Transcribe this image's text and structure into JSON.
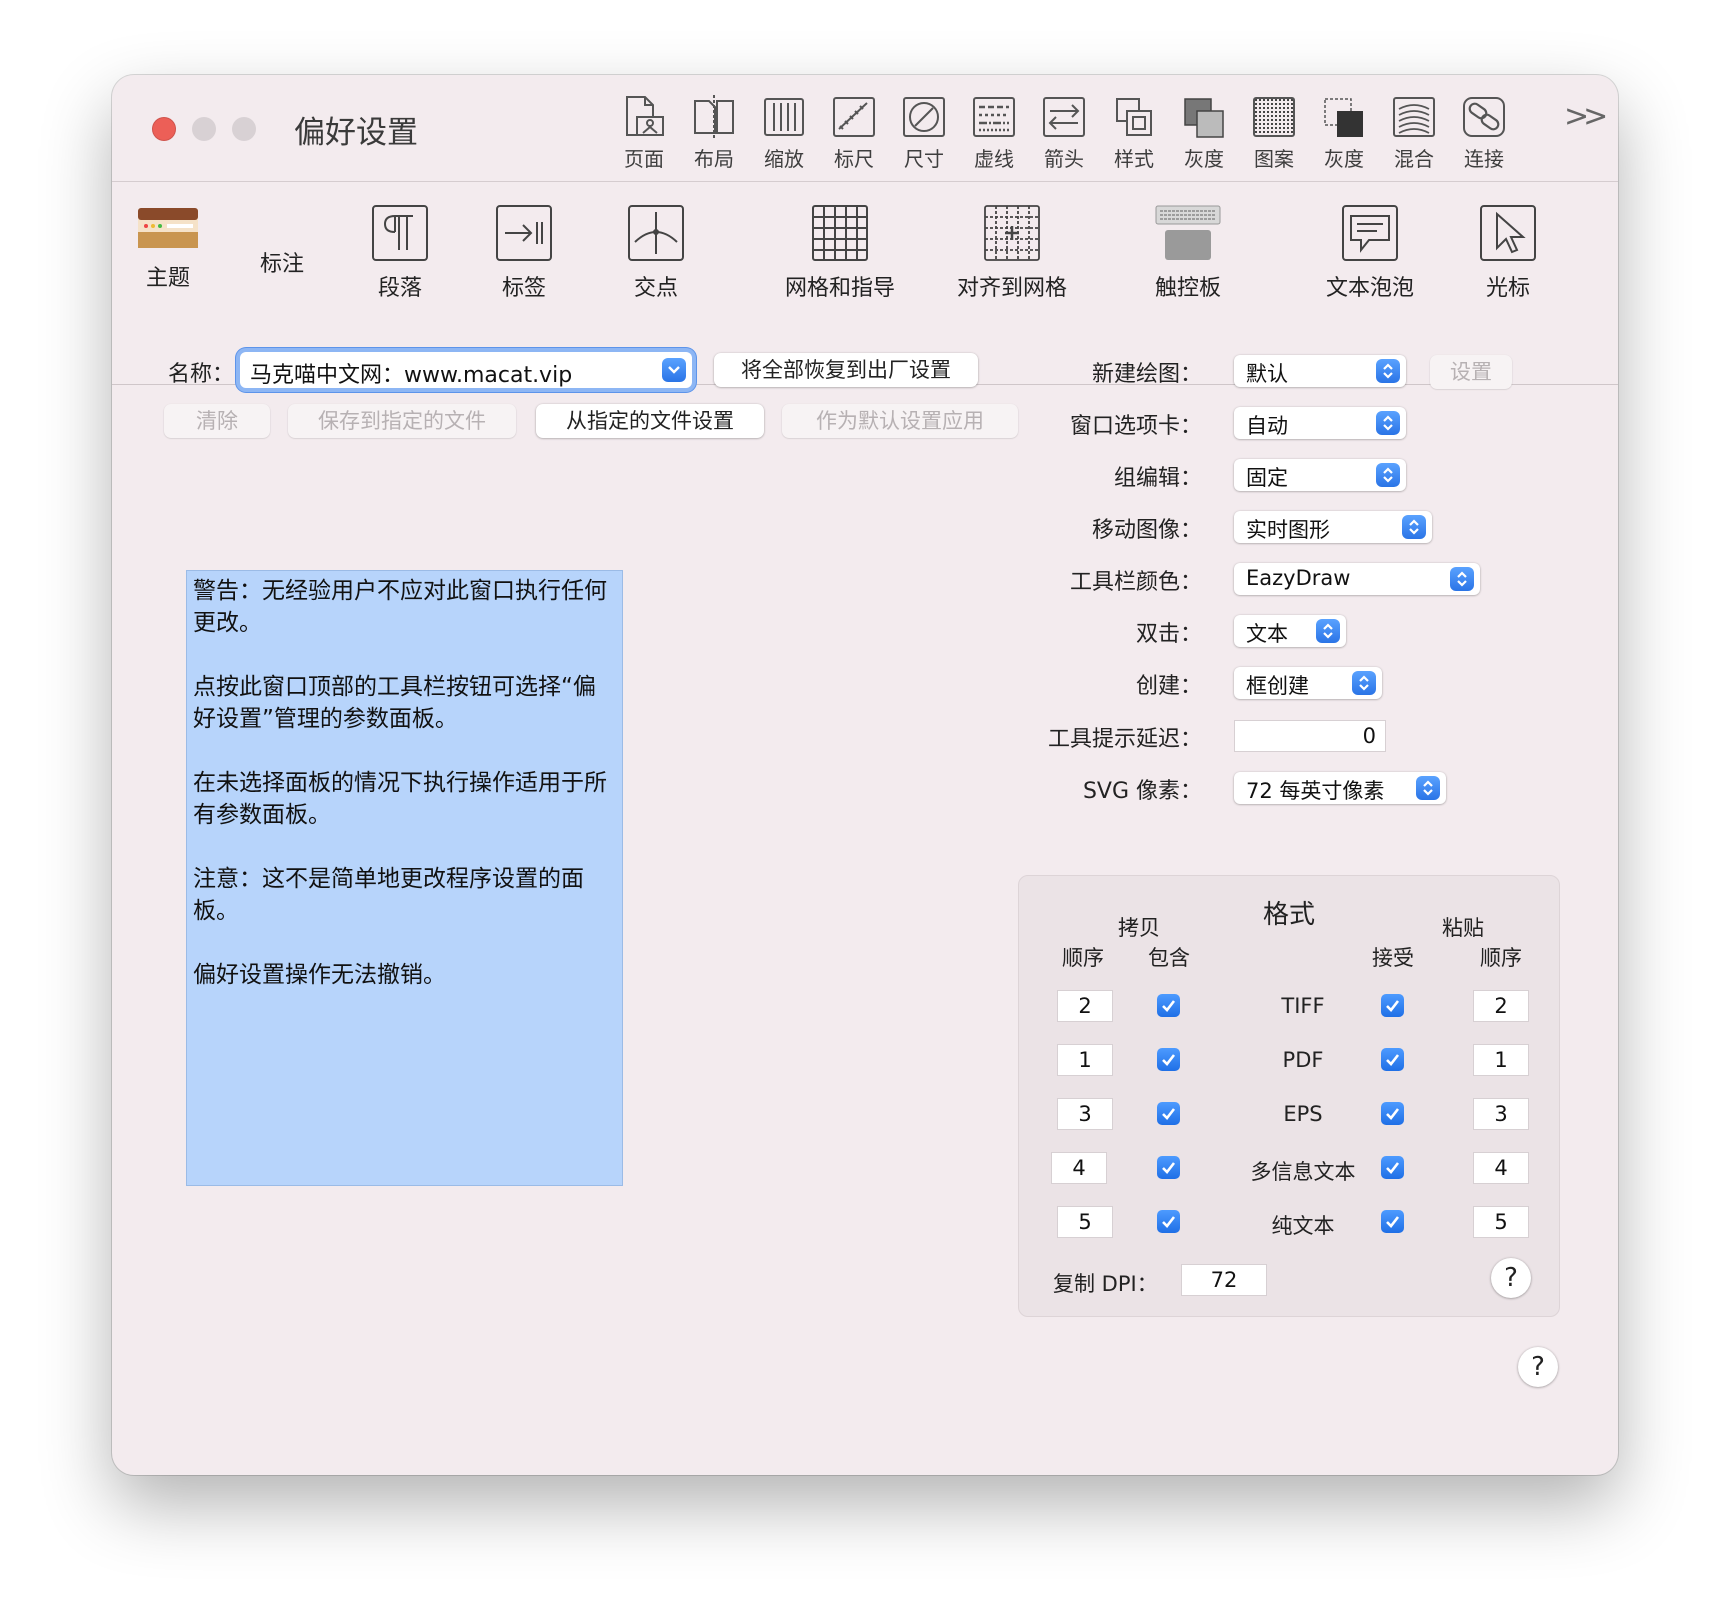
{
  "window": {
    "title": "偏好设置"
  },
  "toolbar": {
    "items": [
      "页面",
      "布局",
      "缩放",
      "标尺",
      "尺寸",
      "虚线",
      "箭头",
      "样式",
      "灰度",
      "图案",
      "灰度",
      "混合",
      "连接"
    ]
  },
  "categories": [
    "主题",
    "标注",
    "段落",
    "标签",
    "交点",
    "网格和指导",
    "对齐到网格",
    "触控板",
    "文本泡泡",
    "光标"
  ],
  "name_row": {
    "label": "名称：",
    "value": "马克喵中文网：www.macat.vip",
    "restore_button": "将全部恢复到出厂设置"
  },
  "actions": {
    "clear": "清除",
    "save_to_file": "保存到指定的文件",
    "set_from_file": "从指定的文件设置",
    "apply_default": "作为默认设置应用"
  },
  "warning": {
    "p1": "警告：无经验用户不应对此窗口执行任何更改。",
    "p2": "点按此窗口顶部的工具栏按钮可选择“偏好设置”管理的参数面板。",
    "p3": "在未选择面板的情况下执行操作适用于所有参数面板。",
    "p4": " 注意：这不是简单地更改程序设置的面板。",
    "p5": "偏好设置操作无法撤销。"
  },
  "settings": {
    "new_drawing": {
      "label": "新建绘图：",
      "value": "默认",
      "button": "设置"
    },
    "window_tabs": {
      "label": "窗口选项卡：",
      "value": "自动"
    },
    "group_edit": {
      "label": "组编辑：",
      "value": "固定"
    },
    "move_image": {
      "label": "移动图像：",
      "value": "实时图形"
    },
    "toolbar_color": {
      "label": "工具栏颜色：",
      "value": "EazyDraw"
    },
    "double_click": {
      "label": "双击：",
      "value": "文本"
    },
    "create": {
      "label": "创建：",
      "value": "框创建"
    },
    "tooltip_delay": {
      "label": "工具提示延迟：",
      "value": "0"
    },
    "svg_pixels": {
      "label": "SVG 像素：",
      "value": "72 每英寸像素"
    }
  },
  "formats": {
    "title": "格式",
    "copy_header": "拷贝",
    "paste_header": "粘贴",
    "col_order": "顺序",
    "col_include": "包含",
    "col_accept": "接受",
    "col_order2": "顺序",
    "rows": [
      {
        "name": "TIFF",
        "copy_order": "2",
        "include": true,
        "accept": true,
        "paste_order": "2"
      },
      {
        "name": "PDF",
        "copy_order": "1",
        "include": true,
        "accept": true,
        "paste_order": "1"
      },
      {
        "name": "EPS",
        "copy_order": "3",
        "include": true,
        "accept": true,
        "paste_order": "3"
      },
      {
        "name": "多信息文本",
        "copy_order": "4",
        "include": true,
        "accept": true,
        "paste_order": "4"
      },
      {
        "name": "纯文本",
        "copy_order": "5",
        "include": true,
        "accept": true,
        "paste_order": "5"
      }
    ],
    "dpi_label": "复制 DPI：",
    "dpi_value": "72",
    "help": "?"
  },
  "help_main": "?",
  "colors": {
    "accent": "#2a74e6",
    "warning_bg": "#b7d4fb",
    "close": "#ec5f57"
  }
}
